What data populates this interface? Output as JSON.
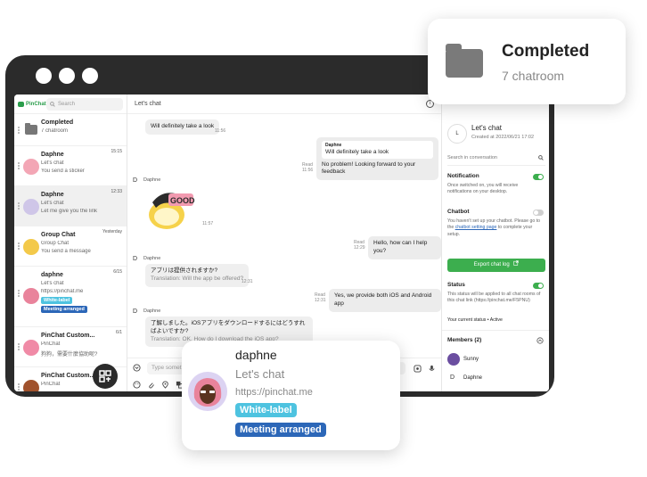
{
  "app": {
    "brand": "PinChat",
    "accent": "#3cae4e"
  },
  "sidebar": {
    "search_placeholder": "Search",
    "rooms": [
      {
        "name": "Completed",
        "sub": "7 chatroom",
        "time": "",
        "last": ""
      },
      {
        "name": "Daphne",
        "sub": "Let's chat",
        "last": "You send a sticker",
        "time": "15:15"
      },
      {
        "name": "Daphne",
        "sub": "Let's chat",
        "last": "Let me give you the link",
        "time": "12:33"
      },
      {
        "name": "Group Chat",
        "sub": "Group Chat",
        "last": "You send a message",
        "time": "Yesterday"
      },
      {
        "name": "daphne",
        "sub": "Let's chat",
        "last": "https://pinchat.me",
        "time": "6/15",
        "tags": [
          "White-label",
          "Meeting arranged"
        ]
      },
      {
        "name": "PinChat Custom...",
        "sub": "PinChat",
        "last": "狗狗，需要什麼協助呢?",
        "time": "6/1"
      },
      {
        "name": "PinChat Custom...",
        "sub": "PinChat",
        "last": "",
        "time": ""
      }
    ]
  },
  "chat": {
    "title": "Let's chat",
    "messages": {
      "m1": "Will definitely take a look",
      "m1_time": "11:56",
      "m2_sender": "Daphne",
      "m2_quote": "Will definitely take a look",
      "m2_text": "No problem! Looking forward to your feedback",
      "m2_read": "Read",
      "m2_time": "11:56",
      "sticker_sender": "Daphne",
      "sticker_time": "11:57",
      "m3": "Hello, how can I help you?",
      "m3_read": "Read",
      "m3_time": "12:29",
      "m4_sender": "Daphne",
      "m4_text": "アプリは提供されますか?",
      "m4_tr": "Translation: Will the app be offered?",
      "m4_time": "12:31",
      "m5": "Yes, we provide both iOS and Android app",
      "m5_read": "Read",
      "m5_time": "12:31",
      "m6_sender": "Daphne",
      "m6_text": "了解しました。iOSアプリをダウンロードするにはどうすればよいですか?",
      "m6_tr": "Translation: OK. How do I download the iOS app?",
      "d_letter": "D"
    },
    "composer_placeholder": "Type something"
  },
  "right_panel": {
    "avatar_letter": "L",
    "title": "Let's chat",
    "created": "Created at 2022/06/21 17:02",
    "search_label": "Search in conversation",
    "notification_title": "Notification",
    "notification_desc": "Once switched on, you will receive notifications on your desktop.",
    "chatbot_title": "Chatbot",
    "chatbot_desc_1": "You haven't set up your chatbot. Please go to the ",
    "chatbot_link": "chatbot setting page",
    "chatbot_desc_2": " to complete your setup.",
    "export_label": "Export chat log",
    "status_title": "Status",
    "status_desc": "This status will be applied to all chat rooms of this chat link (https://pinchat.me/F5PNU)",
    "current_status": "Your current status • Active",
    "members_title": "Members (2)",
    "member_1": "Sunny",
    "member_2": "Daphne",
    "member_2_letter": "D"
  },
  "card_completed": {
    "title": "Completed",
    "sub": "7 chatroom"
  },
  "card_daphne": {
    "name": "daphne",
    "sub": "Let's chat",
    "link": "https://pinchat.me",
    "tag_1": "White-label",
    "tag_2": "Meeting arranged"
  }
}
